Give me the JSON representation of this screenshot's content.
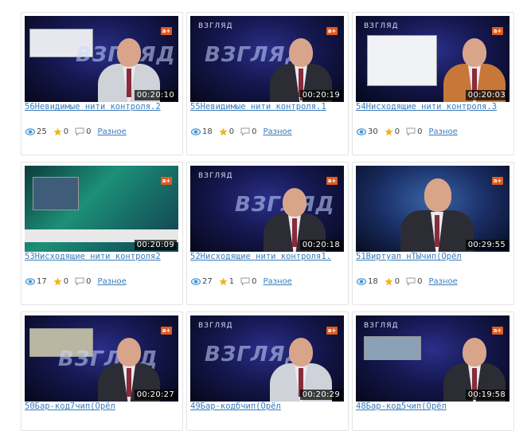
{
  "videos": [
    {
      "title": "56Невидимые нити контроля.2",
      "duration": "00:20:10",
      "views": "25",
      "rating": "0",
      "comments": "0",
      "category": "Разное",
      "logo": "ВЗГЛЯД",
      "channel": "a+"
    },
    {
      "title": "55Невидимые нити контроля.1",
      "duration": "00:20:19",
      "views": "18",
      "rating": "0",
      "comments": "0",
      "category": "Разное",
      "logo": "ВЗГЛЯД",
      "channel": "a+"
    },
    {
      "title": "54Нисходящие нити контроля.3",
      "duration": "00:20:03",
      "views": "30",
      "rating": "0",
      "comments": "0",
      "category": "Разное",
      "logo": "ВЗГЛЯД",
      "channel": "a+"
    },
    {
      "title": "53Нисходящие нити контроля2",
      "duration": "00:20:09",
      "views": "17",
      "rating": "0",
      "comments": "0",
      "category": "Разное",
      "logo": "",
      "channel": "a+"
    },
    {
      "title": "52Нисходящие нити контроля1.",
      "duration": "00:20:18",
      "views": "27",
      "rating": "1",
      "comments": "0",
      "category": "Разное",
      "logo": "ВЗГЛЯД",
      "channel": "a+"
    },
    {
      "title": "51Виртуал нТЫчип(Орёл",
      "duration": "00:29:55",
      "views": "18",
      "rating": "0",
      "comments": "0",
      "category": "Разное",
      "logo": "",
      "channel": "a+"
    },
    {
      "title": "50Бар-код7чип(Орёл",
      "duration": "00:20:27",
      "views": "",
      "rating": "",
      "comments": "",
      "category": "",
      "logo": "ВЗГЛЯД",
      "channel": "a+"
    },
    {
      "title": "49Бар-кодбчип(Орёл",
      "duration": "00:20:29",
      "views": "",
      "rating": "",
      "comments": "",
      "category": "",
      "logo": "ВЗГЛЯД",
      "channel": "a+"
    },
    {
      "title": "48Бар-код5чип(Орёл",
      "duration": "00:19:58",
      "views": "",
      "rating": "",
      "comments": "",
      "category": "",
      "logo": "ВЗГЛЯД",
      "channel": "a+"
    }
  ],
  "icons": {
    "views": "eye-icon",
    "rating": "star-icon",
    "comments": "comment-icon"
  },
  "colors": {
    "link": "#3a7bbd",
    "star": "#f2b418",
    "eye": "#3b8fd0",
    "badge": "#e05a1e"
  }
}
